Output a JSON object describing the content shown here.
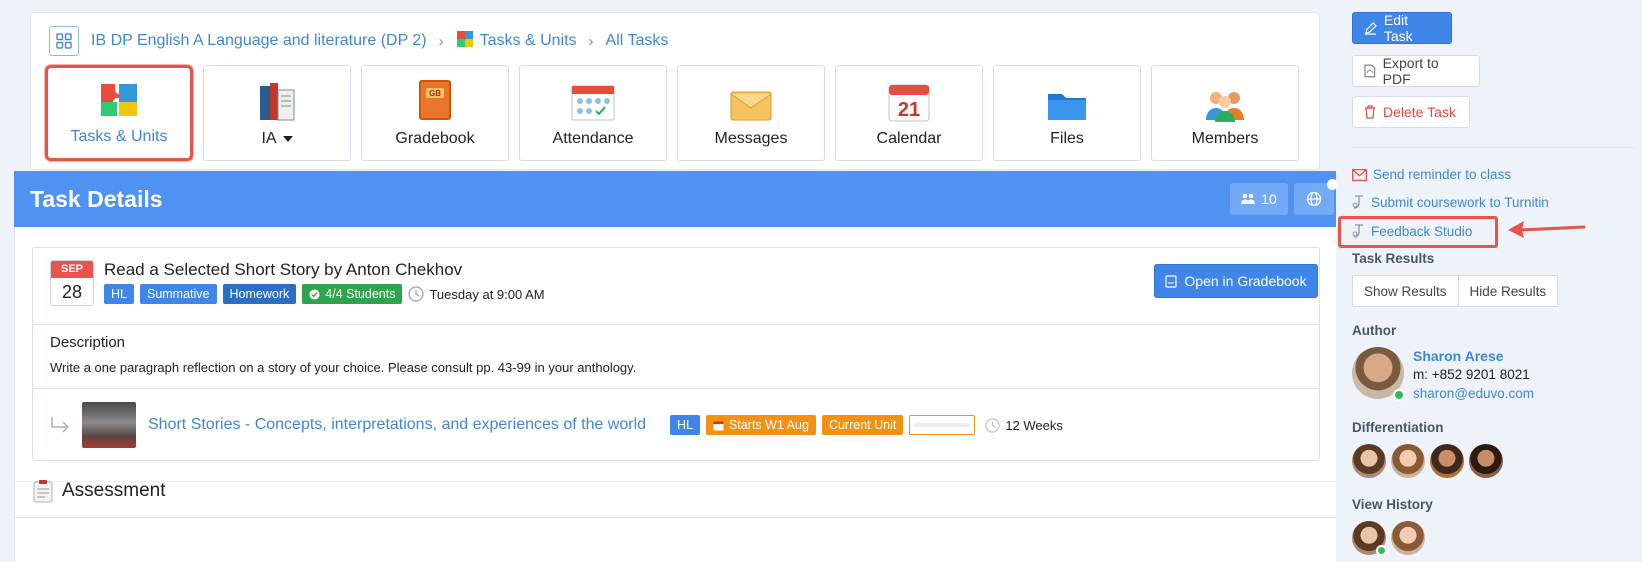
{
  "breadcrumb": {
    "course": "IB DP English A Language and literature (DP 2)",
    "section": "Tasks & Units",
    "page": "All Tasks"
  },
  "tiles": [
    {
      "label": "Tasks & Units",
      "icon": "puzzle-icon",
      "active": true
    },
    {
      "label": "IA",
      "icon": "books-icon"
    },
    {
      "label": "Gradebook",
      "icon": "gradebook-icon"
    },
    {
      "label": "Attendance",
      "icon": "attendance-icon"
    },
    {
      "label": "Messages",
      "icon": "envelope-icon"
    },
    {
      "label": "Calendar",
      "icon": "calendar-icon"
    },
    {
      "label": "Files",
      "icon": "folder-icon"
    },
    {
      "label": "Members",
      "icon": "members-icon"
    }
  ],
  "details": {
    "title": "Task Details",
    "member_count": "10"
  },
  "task": {
    "month": "SEP",
    "day": "28",
    "title": "Read a Selected Short Story by Anton Chekhov",
    "badges": [
      "HL",
      "Summative",
      "Homework",
      "4/4 Students"
    ],
    "due": "Tuesday at 9:00 AM",
    "open_gradebook": "Open in Gradebook",
    "description_label": "Description",
    "description": "Write a one paragraph reflection on a story of your choice. Please consult pp. 43-99 in your anthology."
  },
  "unit": {
    "title": "Short Stories - Concepts, interpretations, and experiences of the world",
    "level": "HL",
    "starts": "Starts W1 Aug",
    "current": "Current Unit",
    "progress": 0,
    "duration": "12 Weeks"
  },
  "assessment": {
    "title": "Assessment"
  },
  "sidebar": {
    "edit": "Edit Task",
    "export": "Export to PDF",
    "delete": "Delete Task",
    "reminder": "Send reminder to class",
    "turnitin": "Submit coursework to Turnitin",
    "feedback": "Feedback Studio",
    "results_label": "Task Results",
    "show_results": "Show Results",
    "hide_results": "Hide Results",
    "author_label": "Author",
    "author_name": "Sharon Arese",
    "author_phone": "m: +852 9201 8021",
    "author_email": "sharon@eduvo.com",
    "differentiation_label": "Differentiation",
    "history_label": "View History"
  },
  "colors": {
    "primary": "#3f86e8",
    "header": "#4f92f2",
    "danger": "#e5453b",
    "highlight": "#e5554a",
    "orange": "#f39212",
    "green": "#2ea44f"
  }
}
